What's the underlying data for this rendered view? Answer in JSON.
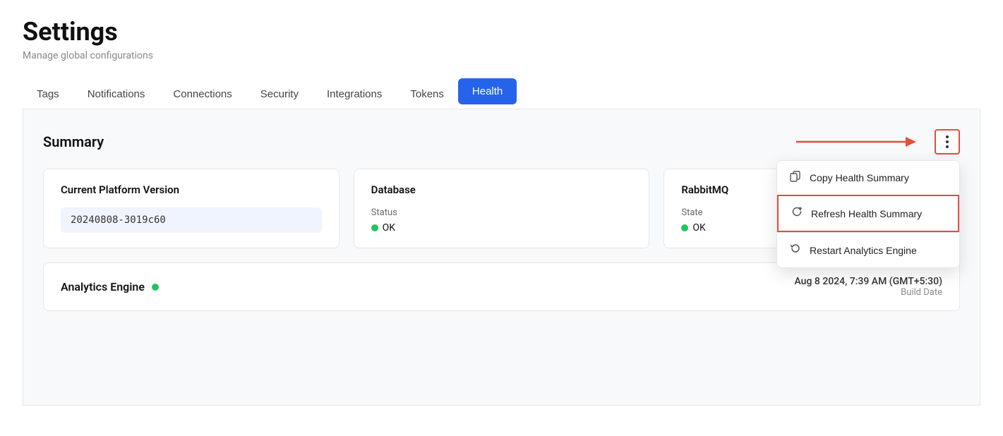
{
  "header": {
    "title": "Settings",
    "subtitle": "Manage global configurations"
  },
  "tabs": [
    {
      "id": "tags",
      "label": "Tags",
      "active": false
    },
    {
      "id": "notifications",
      "label": "Notifications",
      "active": false
    },
    {
      "id": "connections",
      "label": "Connections",
      "active": false
    },
    {
      "id": "security",
      "label": "Security",
      "active": false
    },
    {
      "id": "integrations",
      "label": "Integrations",
      "active": false
    },
    {
      "id": "tokens",
      "label": "Tokens",
      "active": false
    },
    {
      "id": "health",
      "label": "Health",
      "active": true
    }
  ],
  "health": {
    "summary_title": "Summary",
    "cards": [
      {
        "id": "platform-version",
        "title": "Current Platform Version",
        "type": "version",
        "value": "20240808-3019c60"
      },
      {
        "id": "database",
        "title": "Database",
        "type": "status",
        "status_label": "Status",
        "status_value": "OK"
      },
      {
        "id": "rabbitmq",
        "title": "RabbitMQ",
        "type": "status",
        "status_label": "State",
        "status_value": "OK"
      }
    ],
    "analytics_engine": {
      "label": "Analytics Engine",
      "date": "Aug 8 2024, 7:39 AM (GMT+5:30)",
      "build_date_label": "Build Date"
    },
    "menu": {
      "copy_label": "Copy Health Summary",
      "refresh_label": "Refresh Health Summary",
      "restart_label": "Restart Analytics Engine"
    }
  },
  "icons": {
    "three_dots": "⋮",
    "copy": "⧉",
    "refresh": "↺",
    "restart": "⟳"
  }
}
